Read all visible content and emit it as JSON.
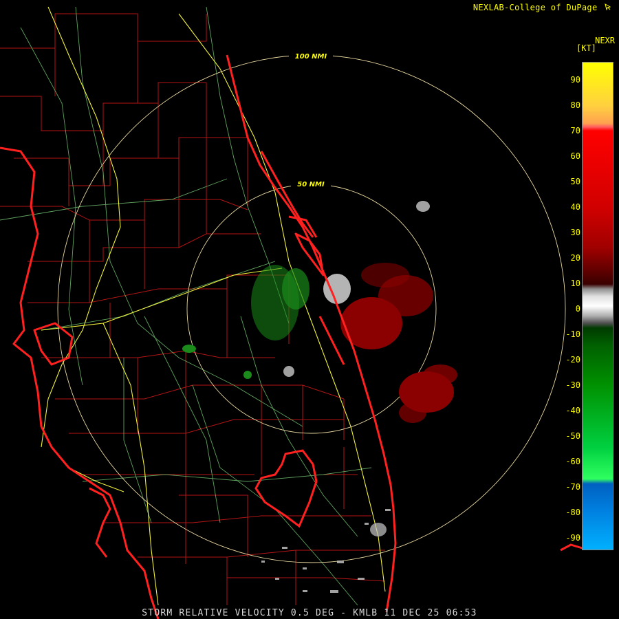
{
  "header": {
    "credit": "NEXLAB-College of DuPage",
    "credit_icon": "cursor-icon"
  },
  "colorbar": {
    "product": "NEXR",
    "units": "[KT]",
    "ticks": [
      "90",
      "80",
      "70",
      "60",
      "50",
      "40",
      "30",
      "20",
      "10",
      "0",
      "-10",
      "-20",
      "-30",
      "-40",
      "-50",
      "-60",
      "-70",
      "-80",
      "-90"
    ]
  },
  "range_rings": {
    "inner": "50 NMI",
    "outer": "100 NMI"
  },
  "footer": {
    "caption": "STORM RELATIVE VELOCITY 0.5 DEG - KMLB 11 DEC 25 06:53"
  },
  "colors": {
    "background": "#000000",
    "coastline": "#ff2020",
    "county_lines": "#c81818",
    "highways": "#ffff40",
    "roads": "#70c070",
    "range_rings": "#e8d8a0",
    "outbound": "#8b0000",
    "near_zero": "#c8c8c8",
    "inbound": "#1a8a1a"
  }
}
